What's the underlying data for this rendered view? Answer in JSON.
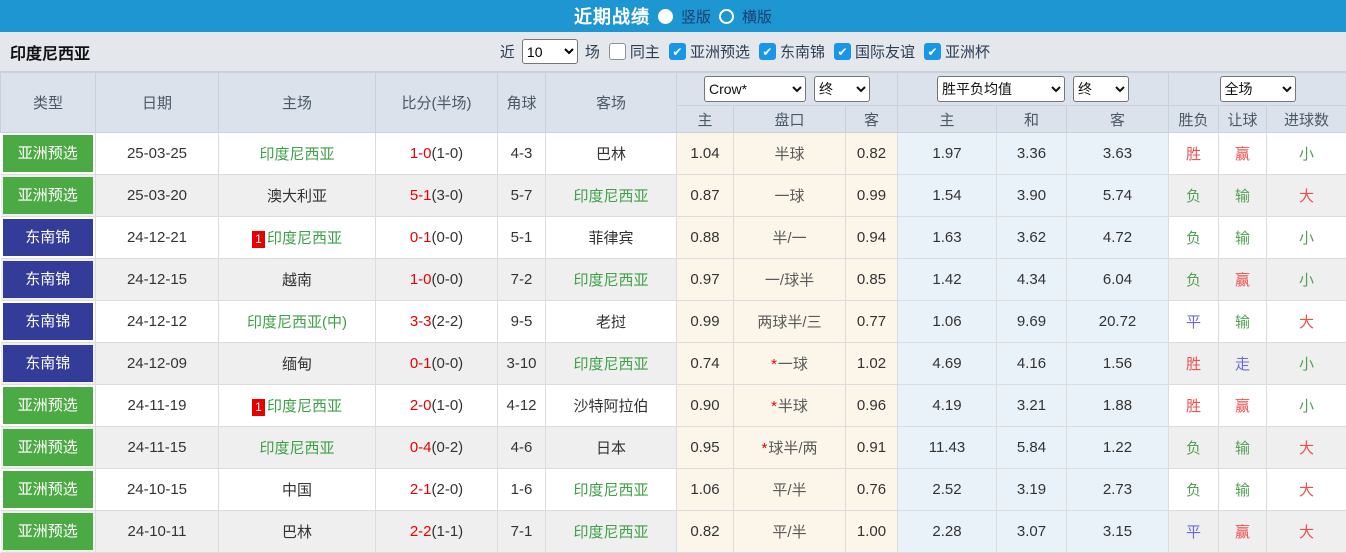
{
  "titlebar": {
    "title": "近期战绩",
    "radio_options": [
      {
        "label": "竖版",
        "selected": true
      },
      {
        "label": "横版",
        "selected": false
      }
    ]
  },
  "filterbar": {
    "team": "印度尼西亚",
    "recent_label": "近",
    "recent_value": "10",
    "matches_label": "场",
    "same_home": {
      "label": "同主",
      "checked": false
    },
    "competitions": [
      {
        "label": "亚洲预选",
        "checked": true
      },
      {
        "label": "东南锦",
        "checked": true
      },
      {
        "label": "国际友谊",
        "checked": true
      },
      {
        "label": "亚洲杯",
        "checked": true
      }
    ]
  },
  "table": {
    "headers": {
      "type": "类型",
      "date": "日期",
      "home": "主场",
      "score": "比分(半场)",
      "corners": "角球",
      "away": "客场"
    },
    "selects": {
      "company": "Crow*",
      "company_time": "终",
      "avg": "胜平负均值",
      "avg_time": "终",
      "scope": "全场"
    },
    "sub_headers": [
      "主",
      "盘口",
      "客",
      "主",
      "和",
      "客",
      "胜负",
      "让球",
      "进球数"
    ],
    "rows": [
      {
        "type": "亚洲预选",
        "type_bg": "#4caa44",
        "date": "25-03-25",
        "redcard": "",
        "home": "印度尼西亚",
        "home_color": "#3fa047",
        "score": "1-0",
        "half": "(1-0)",
        "corners": "4-3",
        "away": "巴林",
        "away_color": "#333333",
        "o1": "1.04",
        "star": "",
        "handicap": "半球",
        "o2": "0.82",
        "a1": "1.97",
        "a2": "3.36",
        "a3": "3.63",
        "res": "胜",
        "res_color": "#ee5050",
        "hres": "赢",
        "hres_color": "#ee5050",
        "goals": "小",
        "goals_color": "#55a055"
      },
      {
        "type": "亚洲预选",
        "type_bg": "#4caa44",
        "date": "25-03-20",
        "redcard": "",
        "home": "澳大利亚",
        "home_color": "#333333",
        "score": "5-1",
        "half": "(3-0)",
        "corners": "5-7",
        "away": "印度尼西亚",
        "away_color": "#3fa047",
        "o1": "0.87",
        "star": "",
        "handicap": "一球",
        "o2": "0.99",
        "a1": "1.54",
        "a2": "3.90",
        "a3": "5.74",
        "res": "负",
        "res_color": "#55a055",
        "hres": "输",
        "hres_color": "#55a055",
        "goals": "大",
        "goals_color": "#ee5050"
      },
      {
        "type": "东南锦",
        "type_bg": "#333d99",
        "date": "24-12-21",
        "redcard": "1",
        "home": "印度尼西亚",
        "home_color": "#3fa047",
        "score": "0-1",
        "half": "(0-0)",
        "corners": "5-1",
        "away": "菲律宾",
        "away_color": "#333333",
        "o1": "0.88",
        "star": "",
        "handicap": "半/一",
        "o2": "0.94",
        "a1": "1.63",
        "a2": "3.62",
        "a3": "4.72",
        "res": "负",
        "res_color": "#55a055",
        "hres": "输",
        "hres_color": "#55a055",
        "goals": "小",
        "goals_color": "#55a055"
      },
      {
        "type": "东南锦",
        "type_bg": "#333d99",
        "date": "24-12-15",
        "redcard": "",
        "home": "越南",
        "home_color": "#333333",
        "score": "1-0",
        "half": "(0-0)",
        "corners": "7-2",
        "away": "印度尼西亚",
        "away_color": "#3fa047",
        "o1": "0.97",
        "star": "",
        "handicap": "一/球半",
        "o2": "0.85",
        "a1": "1.42",
        "a2": "4.34",
        "a3": "6.04",
        "res": "负",
        "res_color": "#55a055",
        "hres": "赢",
        "hres_color": "#ee5050",
        "goals": "小",
        "goals_color": "#55a055"
      },
      {
        "type": "东南锦",
        "type_bg": "#333d99",
        "date": "24-12-12",
        "redcard": "",
        "home": "印度尼西亚(中)",
        "home_color": "#3fa047",
        "score": "3-3",
        "half": "(2-2)",
        "corners": "9-5",
        "away": "老挝",
        "away_color": "#333333",
        "o1": "0.99",
        "star": "",
        "handicap": "两球半/三",
        "o2": "0.77",
        "a1": "1.06",
        "a2": "9.69",
        "a3": "20.72",
        "res": "平",
        "res_color": "#6a6ade",
        "hres": "输",
        "hres_color": "#55a055",
        "goals": "大",
        "goals_color": "#ee5050"
      },
      {
        "type": "东南锦",
        "type_bg": "#333d99",
        "date": "24-12-09",
        "redcard": "",
        "home": "缅甸",
        "home_color": "#333333",
        "score": "0-1",
        "half": "(0-0)",
        "corners": "3-10",
        "away": "印度尼西亚",
        "away_color": "#3fa047",
        "o1": "0.74",
        "star": "*",
        "handicap": "一球",
        "o2": "1.02",
        "a1": "4.69",
        "a2": "4.16",
        "a3": "1.56",
        "res": "胜",
        "res_color": "#ee5050",
        "hres": "走",
        "hres_color": "#6a6ade",
        "goals": "小",
        "goals_color": "#55a055"
      },
      {
        "type": "亚洲预选",
        "type_bg": "#4caa44",
        "date": "24-11-19",
        "redcard": "1",
        "home": "印度尼西亚",
        "home_color": "#3fa047",
        "score": "2-0",
        "half": "(1-0)",
        "corners": "4-12",
        "away": "沙特阿拉伯",
        "away_color": "#333333",
        "o1": "0.90",
        "star": "*",
        "handicap": "半球",
        "o2": "0.96",
        "a1": "4.19",
        "a2": "3.21",
        "a3": "1.88",
        "res": "胜",
        "res_color": "#ee5050",
        "hres": "赢",
        "hres_color": "#ee5050",
        "goals": "小",
        "goals_color": "#55a055"
      },
      {
        "type": "亚洲预选",
        "type_bg": "#4caa44",
        "date": "24-11-15",
        "redcard": "",
        "home": "印度尼西亚",
        "home_color": "#3fa047",
        "score": "0-4",
        "half": "(0-2)",
        "corners": "4-6",
        "away": "日本",
        "away_color": "#333333",
        "o1": "0.95",
        "star": "*",
        "handicap": "球半/两",
        "o2": "0.91",
        "a1": "11.43",
        "a2": "5.84",
        "a3": "1.22",
        "res": "负",
        "res_color": "#55a055",
        "hres": "输",
        "hres_color": "#55a055",
        "goals": "大",
        "goals_color": "#ee5050"
      },
      {
        "type": "亚洲预选",
        "type_bg": "#4caa44",
        "date": "24-10-15",
        "redcard": "",
        "home": "中国",
        "home_color": "#333333",
        "score": "2-1",
        "half": "(2-0)",
        "corners": "1-6",
        "away": "印度尼西亚",
        "away_color": "#3fa047",
        "o1": "1.06",
        "star": "",
        "handicap": "平/半",
        "o2": "0.76",
        "a1": "2.52",
        "a2": "3.19",
        "a3": "2.73",
        "res": "负",
        "res_color": "#55a055",
        "hres": "输",
        "hres_color": "#55a055",
        "goals": "大",
        "goals_color": "#ee5050"
      },
      {
        "type": "亚洲预选",
        "type_bg": "#4caa44",
        "date": "24-10-11",
        "redcard": "",
        "home": "巴林",
        "home_color": "#333333",
        "score": "2-2",
        "half": "(1-1)",
        "corners": "7-1",
        "away": "印度尼西亚",
        "away_color": "#3fa047",
        "o1": "0.82",
        "star": "",
        "handicap": "平/半",
        "o2": "1.00",
        "a1": "2.28",
        "a2": "3.07",
        "a3": "3.15",
        "res": "平",
        "res_color": "#6a6ade",
        "hres": "赢",
        "hres_color": "#ee5050",
        "goals": "大",
        "goals_color": "#ee5050"
      }
    ]
  },
  "colors": {
    "accent_blue": "#1e96d2",
    "badge_green": "#4caa44",
    "badge_navy": "#333d99",
    "team_green": "#3fa047",
    "score_red": "#e80000",
    "win_red": "#ee5050",
    "draw_blue": "#6a6ade",
    "lose_green": "#55a055",
    "odds_cream_bg": "#fcf5ea",
    "avg_blue_bg": "#e9f2f9",
    "header_bg": "#dbe2eb"
  }
}
